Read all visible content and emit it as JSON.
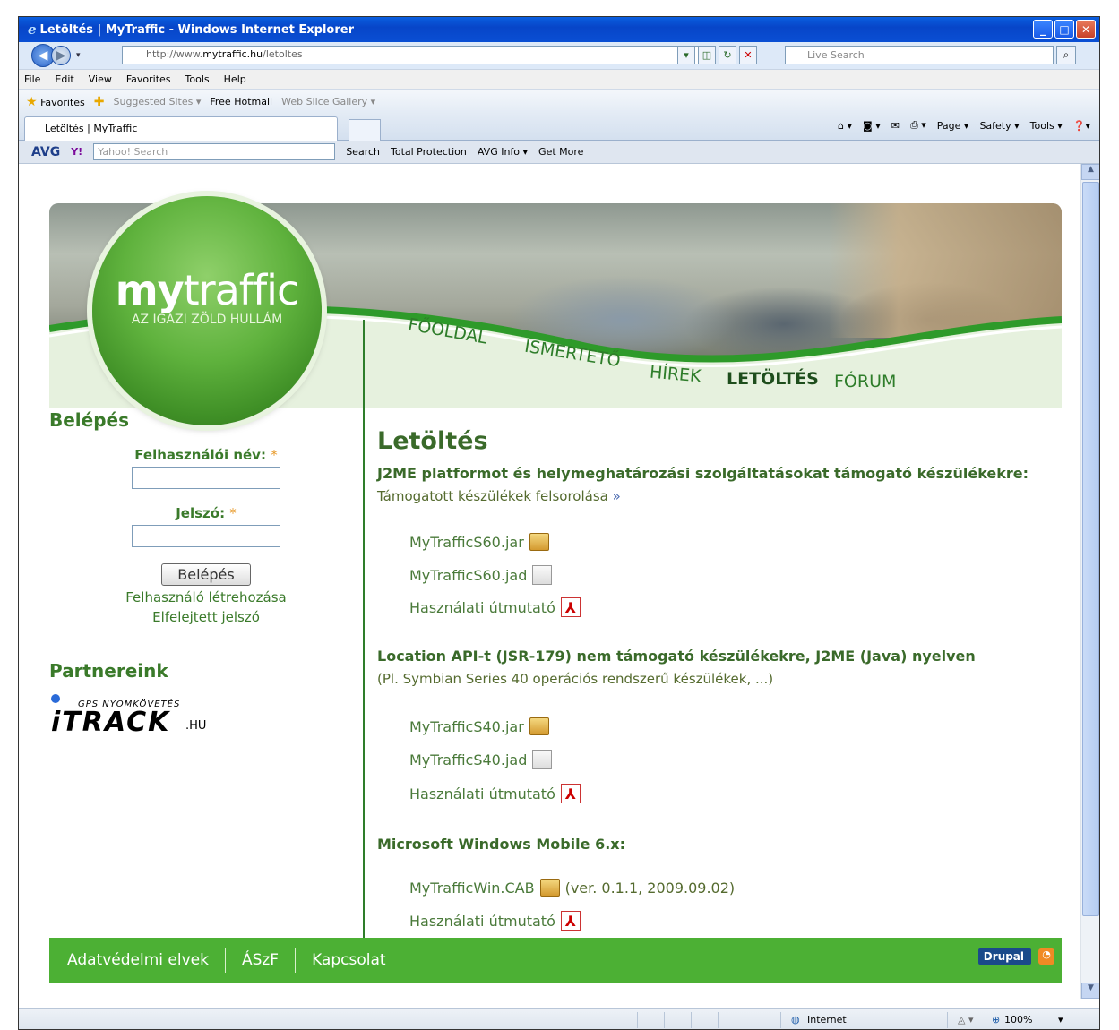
{
  "window": {
    "title": "Letöltés | MyTraffic - Windows Internet Explorer",
    "ie_glyph": "e"
  },
  "address": {
    "url_prefix": "http://www.",
    "url_domain": "mytraffic.hu",
    "url_path": "/letoltes",
    "live_search_placeholder": "Live Search"
  },
  "menu": [
    "File",
    "Edit",
    "View",
    "Favorites",
    "Tools",
    "Help"
  ],
  "favorites": {
    "label": "Favorites",
    "items": [
      "Suggested Sites ▾",
      "Free Hotmail",
      "Web Slice Gallery ▾"
    ]
  },
  "tab": {
    "label": "Letöltés | MyTraffic",
    "commands": [
      "Page ▾",
      "Safety ▾",
      "Tools ▾"
    ]
  },
  "avgbar": {
    "avg": "AVG",
    "yahoo": "Y!",
    "yahoo_placeholder": "Yahoo! Search",
    "search": "Search",
    "total_protection": "Total Protection",
    "avg_info": "AVG Info ▾",
    "get_more": "Get More"
  },
  "site": {
    "logo_bold": "my",
    "logo_rest": "traffic",
    "tagline": "AZ IGAZI ZÖLD HULLÁM",
    "nav": [
      {
        "label": "FŐOLDAL"
      },
      {
        "label": "ISMERTETŐ"
      },
      {
        "label": "HÍREK"
      },
      {
        "label": "LETÖLTÉS"
      },
      {
        "label": "FÓRUM"
      }
    ],
    "login": {
      "title": "Belépés",
      "user_label": "Felhasználói név:",
      "pass_label": "Jelszó:",
      "required": "*",
      "button": "Belépés",
      "create": "Felhasználó létrehozása",
      "forgot": "Elfelejtett jelszó"
    },
    "partners": {
      "title": "Partnereink",
      "logo_top": "GPS NYOMKÖVETÉS",
      "logo_main": "iTRACK",
      "logo_suffix": ".HU"
    },
    "main": {
      "heading": "Letöltés",
      "sections": [
        {
          "title": "J2ME platformot és helymeghatározási szolgáltatásokat támogató készülékekre:",
          "subtitle": "Támogatott készülékek felsorolása",
          "subtitle_link": "»",
          "files": [
            {
              "name": "MyTrafficS60.jar",
              "icon": "jar-icon"
            },
            {
              "name": "MyTrafficS60.jad",
              "icon": "jad-icon"
            },
            {
              "name": "Használati útmutató",
              "icon": "pdf-icon"
            }
          ]
        },
        {
          "title": "Location API-t (JSR-179) nem támogató készülékekre, J2ME (Java) nyelven",
          "subtitle": "(Pl. Symbian Series 40 operációs rendszerű készülékek, ...)",
          "files": [
            {
              "name": "MyTrafficS40.jar",
              "icon": "jar-icon"
            },
            {
              "name": "MyTrafficS40.jad",
              "icon": "jad-icon"
            },
            {
              "name": "Használati útmutató",
              "icon": "pdf-icon"
            }
          ]
        },
        {
          "title": "Microsoft Windows Mobile 6.x:",
          "files": [
            {
              "name": "MyTrafficWin.CAB",
              "icon": "cab-icon",
              "extra": "(ver. 0.1.1, 2009.09.02)"
            },
            {
              "name": "Használati útmutató",
              "icon": "pdf-icon"
            }
          ]
        }
      ]
    },
    "footer": {
      "links": [
        "Adatvédelmi elvek",
        "ÁSzF",
        "Kapcsolat"
      ],
      "drupal": "Drupal"
    }
  },
  "status": {
    "zone": "Internet",
    "zoom": "100%"
  },
  "colors": {
    "brand_green": "#4cb034",
    "text_green": "#3a7a2a",
    "ie_blue": "#0a5fe0"
  }
}
